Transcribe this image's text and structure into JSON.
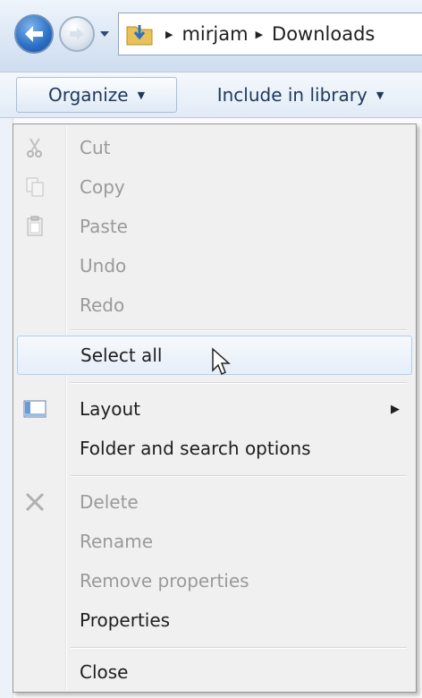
{
  "address_bar": {
    "icons": [
      "back-arrow-icon",
      "forward-arrow-icon",
      "history-dropdown-icon",
      "folder-download-icon"
    ],
    "breadcrumbs": [
      "mirjam",
      "Downloads"
    ]
  },
  "toolbar": {
    "organize_label": "Organize",
    "include_label": "Include in library"
  },
  "menu": {
    "cut": "Cut",
    "copy": "Copy",
    "paste": "Paste",
    "undo": "Undo",
    "redo": "Redo",
    "select_all": "Select all",
    "layout": "Layout",
    "folder_options": "Folder and search options",
    "delete": "Delete",
    "rename": "Rename",
    "remove_properties": "Remove properties",
    "properties": "Properties",
    "close": "Close"
  },
  "colors": {
    "accent": "#2a6fc4",
    "disabled_text": "#9a9a9a",
    "hover_border": "#aecff7"
  }
}
